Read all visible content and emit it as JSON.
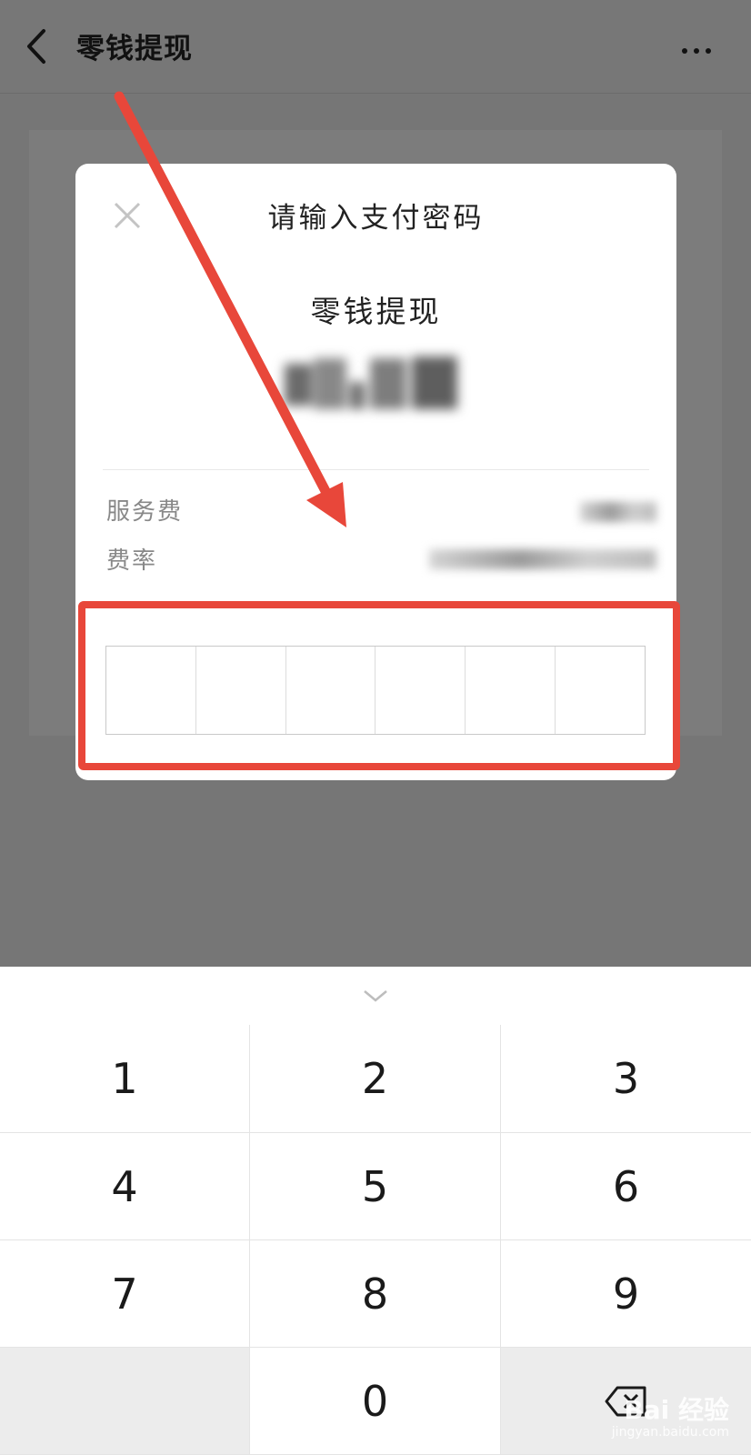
{
  "header": {
    "title": "零钱提现"
  },
  "dialog": {
    "title": "请输入支付密码",
    "pay_item": "零钱提现",
    "fee_label": "服务费",
    "rate_label": "费率"
  },
  "password": {
    "length": 6
  },
  "keyboard": {
    "keys": [
      "1",
      "2",
      "3",
      "4",
      "5",
      "6",
      "7",
      "8",
      "9",
      "0"
    ]
  },
  "watermark": {
    "main": "Bai 经验",
    "sub": "jingyan.baidu.com"
  },
  "colors": {
    "highlight": "#e8473a",
    "overlay": "#767676"
  }
}
